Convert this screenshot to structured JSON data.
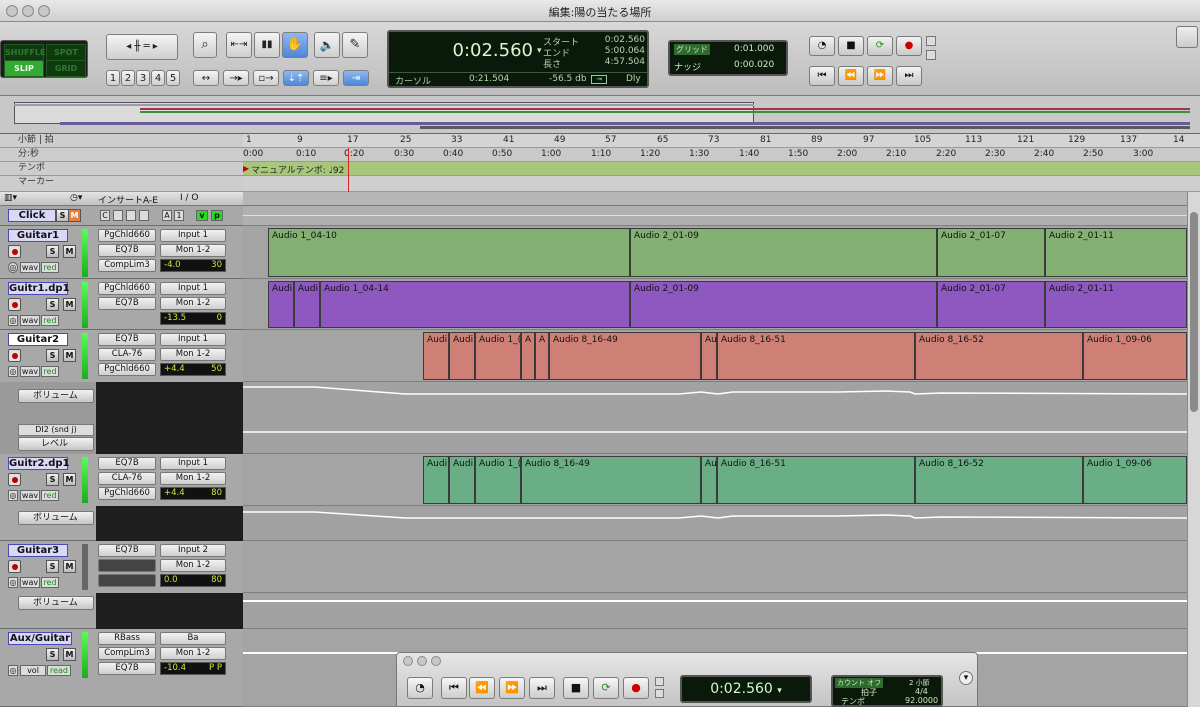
{
  "window": {
    "title": "編集:陽の当たる場所"
  },
  "edit_modes": {
    "shuffle": "SHUFFLE",
    "spot": "SPOT",
    "slip": "SLIP",
    "grid": "GRID"
  },
  "zoom_presets": [
    "1",
    "2",
    "3",
    "4",
    "5"
  ],
  "counter": {
    "main": "0:02.560",
    "start_label": "スタート",
    "start_value": "0:02.560",
    "end_label": "エンド",
    "end_value": "5:00.064",
    "length_label": "長さ",
    "length_value": "4:57.504",
    "cursor_label": "カーソル",
    "cursor_value": "0:21.504",
    "db_value": "-56.5 db",
    "dly_label": "Dly"
  },
  "grid": {
    "grid_label": "グリッド",
    "grid_value": "0:01.000",
    "nudge_label": "ナッジ",
    "nudge_value": "0:00.020"
  },
  "rulers": {
    "bars_label": "小節 | 拍",
    "minsec_label": "分:秒",
    "tempo_label": "テンポ",
    "marker_label": "マーカー",
    "bar_ticks": [
      "1",
      "9",
      "17",
      "25",
      "33",
      "41",
      "49",
      "57",
      "65",
      "73",
      "81",
      "89",
      "97",
      "105",
      "113",
      "121",
      "129",
      "137",
      "14"
    ],
    "time_ticks": [
      "0:00",
      "0:10",
      "0:20",
      "0:30",
      "0:40",
      "0:50",
      "1:00",
      "1:10",
      "1:20",
      "1:30",
      "1:40",
      "1:50",
      "2:00",
      "2:10",
      "2:20",
      "2:30",
      "2:40",
      "2:50",
      "3:00"
    ],
    "tempo_text": "マニュアルテンポ: ♩92"
  },
  "header": {
    "inserts_label": "インサートA-E",
    "io_label": "I / O"
  },
  "tracks": [
    {
      "name": "Click",
      "inserts": [
        "C"
      ],
      "io": [
        "A",
        "1"
      ],
      "vp": [
        "v",
        "p"
      ]
    },
    {
      "name": "Guitar1",
      "inserts": [
        "PgChld660",
        "EQ7B",
        "CompLim3"
      ],
      "io": [
        "Input 1",
        "Mon 1-2"
      ],
      "vol": "-4.0",
      "pan": "30",
      "view": "wav",
      "auto": "red"
    },
    {
      "name": "Guitr1.dp1",
      "inserts": [
        "PgChld660",
        "EQ7B"
      ],
      "io": [
        "Input 1",
        "Mon 1-2"
      ],
      "vol": "-13.5",
      "pan": "0",
      "view": "wav",
      "auto": "red"
    },
    {
      "name": "Guitar2",
      "inserts": [
        "EQ7B",
        "CLA-76",
        "PgChld660"
      ],
      "io": [
        "Input 1",
        "Mon 1-2"
      ],
      "vol": "+4.4",
      "pan": "50",
      "view": "wav",
      "auto": "red",
      "lane1": "ボリューム",
      "lane2_name": "DI2 (snd j)",
      "lane2": "レベル"
    },
    {
      "name": "Guitr2.dp1",
      "inserts": [
        "EQ7B",
        "CLA-76",
        "PgChld660"
      ],
      "io": [
        "Input 1",
        "Mon 1-2"
      ],
      "vol": "+4.4",
      "pan": "80",
      "view": "wav",
      "auto": "red",
      "lane1": "ボリューム"
    },
    {
      "name": "Guitar3",
      "inserts": [
        "EQ7B"
      ],
      "io": [
        "Input 2",
        "Mon 1-2"
      ],
      "vol": "0.0",
      "pan": "80",
      "view": "wav",
      "auto": "red",
      "lane1": "ボリューム"
    },
    {
      "name": "Aux/Guitar",
      "inserts": [
        "RBass",
        "CompLim3",
        "EQ7B"
      ],
      "io": [
        "Ba",
        "Mon 1-2"
      ],
      "vol": "-10.4",
      "pan": "P",
      "pan2": "P",
      "view": "vol",
      "auto": "read"
    }
  ],
  "clips": {
    "guitar1": [
      "Audio 1_04-10",
      "Audio 2_01-09",
      "Audio 2_01-07",
      "Audio 2_01-11"
    ],
    "guitr1dp": [
      "Audi",
      "Audi",
      "Audio 1_04-14",
      "Audio 2_01-09",
      "Audio 2_01-07",
      "Audio 2_01-11"
    ],
    "guitar2": [
      "Audi",
      "Audi",
      "Audio 1_(",
      "A",
      "A",
      "Audio 8_16-49",
      "Au",
      "Audio 8_16-51",
      "Audio 8_16-52",
      "Audio 1_09-06"
    ],
    "guitr2dp": [
      "Audi",
      "Audi",
      "Audio 1_(",
      "Audio 8_16-49",
      "Au",
      "Audio 8_16-51",
      "Audio 8_16-52",
      "Audio 1_09-06"
    ]
  },
  "transport": {
    "counter": "0:02.560",
    "count_off": "カウント オフ",
    "meter_label": "拍子",
    "meter_value": "4/4",
    "tempo_label": "テンポ",
    "tempo_value": "92.0000",
    "bars": "2 小節"
  },
  "colors": {
    "guitar1": "#84b074",
    "guitr1dp": "#8e58c0",
    "guitar2": "#cf8076",
    "guitr2dp": "#6aae86",
    "lcd": "#0a1a0a"
  }
}
